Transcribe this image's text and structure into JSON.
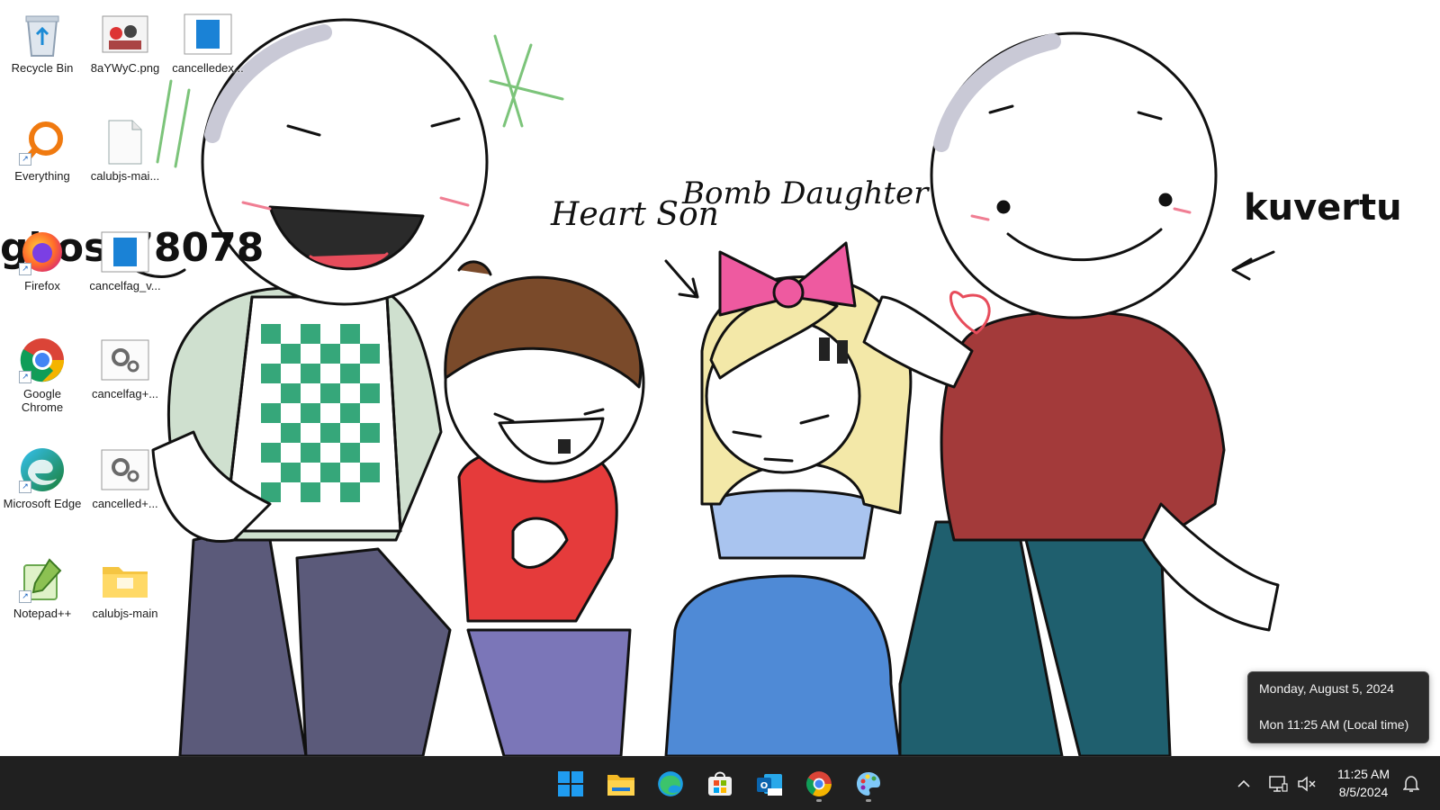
{
  "wallpaper": {
    "labels": {
      "heart_son": "Heart Son",
      "bomb_daughter": "Bomb Daughter",
      "kuvertu": "kuvertu",
      "ghost": "ghost78078"
    }
  },
  "desktop_icons": [
    {
      "label": "Recycle Bin",
      "icon": "recycle-bin-icon"
    },
    {
      "label": "8aYWyC.png",
      "icon": "image-file-icon"
    },
    {
      "label": "cancelledex...",
      "icon": "app-window-icon"
    },
    {
      "label": "Everything",
      "icon": "search-magnifier-icon"
    },
    {
      "label": "calubjs-mai...",
      "icon": "blank-file-icon"
    },
    {
      "label": "Firefox",
      "icon": "firefox-icon"
    },
    {
      "label": "cancelfag_v...",
      "icon": "app-window-icon"
    },
    {
      "label": "Google Chrome",
      "icon": "chrome-icon"
    },
    {
      "label": "cancelfag+...",
      "icon": "settings-file-icon"
    },
    {
      "label": "Microsoft Edge",
      "icon": "edge-icon"
    },
    {
      "label": "cancelled+...",
      "icon": "settings-file-icon"
    },
    {
      "label": "Notepad++",
      "icon": "notepad-plus-plus-icon"
    },
    {
      "label": "calubjs-main",
      "icon": "folder-icon"
    }
  ],
  "taskbar": {
    "apps": [
      {
        "name": "start",
        "icon": "windows-logo-icon",
        "running": false
      },
      {
        "name": "file-explorer",
        "icon": "folder-icon",
        "running": false
      },
      {
        "name": "edge",
        "icon": "edge-icon",
        "running": false
      },
      {
        "name": "microsoft-store",
        "icon": "store-icon",
        "running": false
      },
      {
        "name": "outlook-new",
        "icon": "outlook-icon",
        "running": false
      },
      {
        "name": "chrome",
        "icon": "chrome-icon",
        "running": true
      },
      {
        "name": "paint",
        "icon": "paint-palette-icon",
        "running": true
      }
    ],
    "clock": {
      "time": "11:25 AM",
      "date": "8/5/2024"
    },
    "tray": {
      "chevron": "chevron-up-icon",
      "network": "network-icon",
      "volume": "volume-muted-icon",
      "notifications": "bell-icon"
    }
  },
  "tooltip": {
    "line1": "Monday, August 5, 2024",
    "line2": "Mon 11:25 AM (Local time)"
  },
  "colors": {
    "taskbar_bg": "#202020",
    "windows_blue": "#0a84d9",
    "bow_pink": "#ee5aa0",
    "shirt_red": "#a33a3a",
    "jeans_teal": "#1f5f6e",
    "vest_green": "#2f9a6a"
  }
}
